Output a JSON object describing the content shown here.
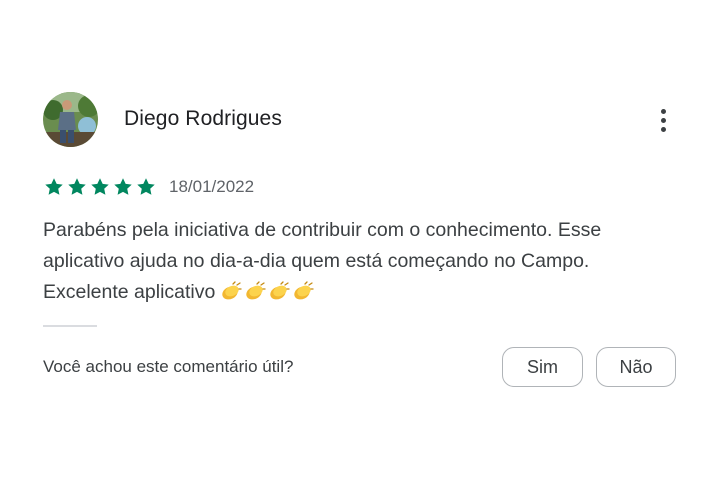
{
  "review": {
    "author_name": "Diego Rodrigues",
    "rating": 5,
    "rating_max": 5,
    "date": "18/01/2022",
    "text_lines": [
      "Parabéns pela iniciativa de contribuir com o conhecimento. Esse",
      "aplicativo ajuda no dia-a-dia quem está começando no Campo.",
      "Excelente aplicativo"
    ],
    "emoji_icons": [
      "clapping-hands-icon",
      "clapping-hands-icon",
      "clapping-hands-icon",
      "clapping-hands-icon"
    ]
  },
  "feedback": {
    "question": "Você achou este comentário útil?",
    "yes_label": "Sim",
    "no_label": "Não"
  },
  "colors": {
    "star": "#01875f",
    "text": "#3c4043",
    "secondary_text": "#5f6368",
    "border": "#b0b4b8"
  },
  "icons": {
    "menu": "more-vert-icon",
    "star": "star-icon",
    "avatar": "avatar-photo"
  }
}
